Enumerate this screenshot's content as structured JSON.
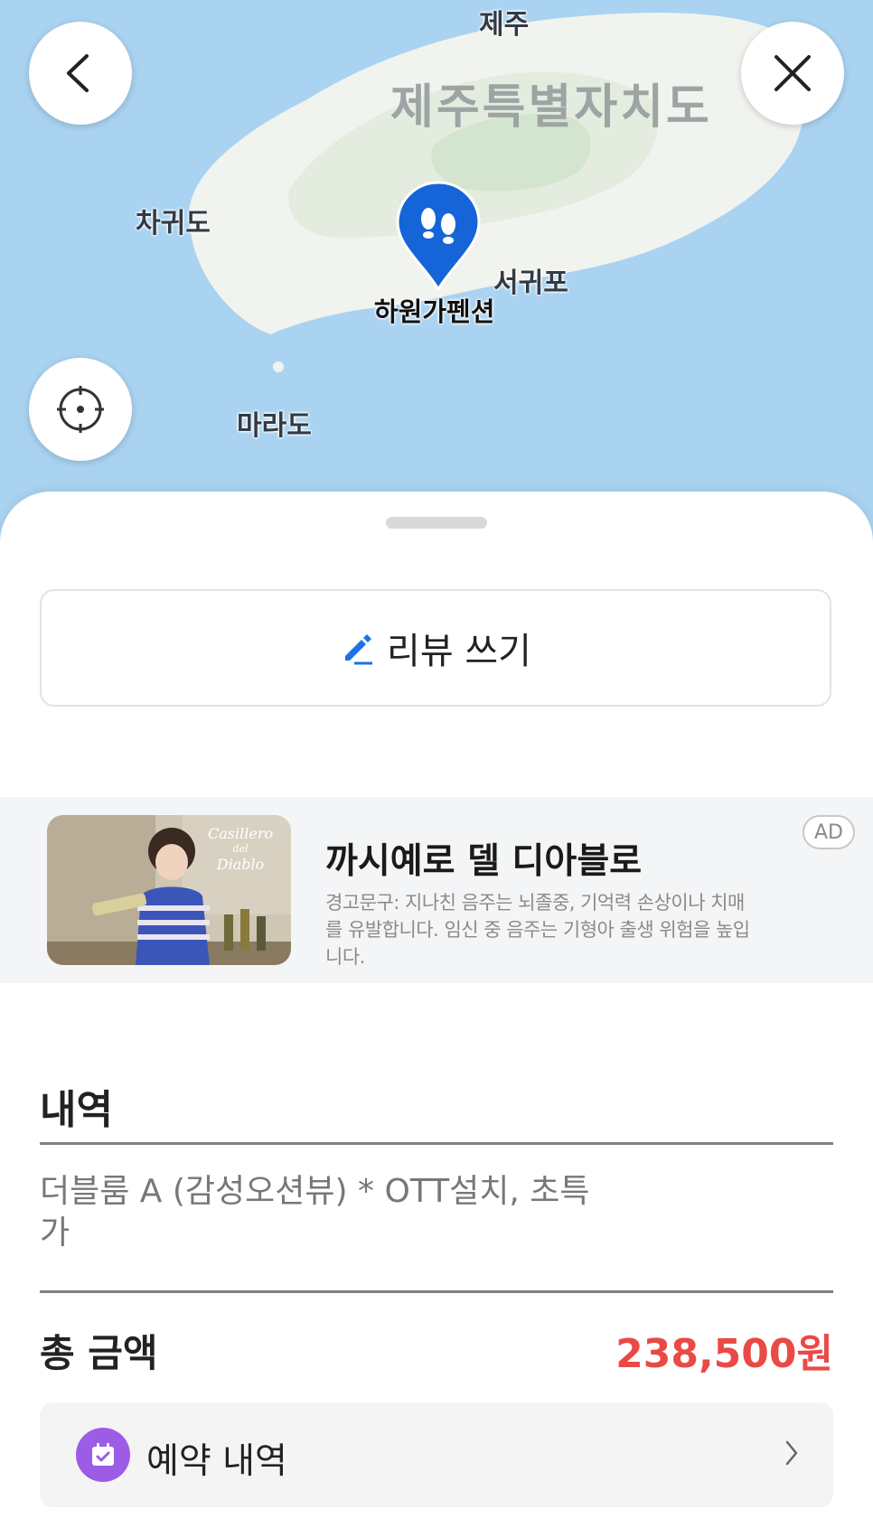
{
  "map": {
    "labels": {
      "jeju_city": "제주",
      "province": "제주특별자치도",
      "chagwido": "차귀도",
      "seogwipo": "서귀포",
      "marado": "마라도",
      "pin_place": "하원가펜션"
    },
    "buttons": {
      "back_icon": "chevron-left-icon",
      "close_icon": "close-icon",
      "locate_icon": "crosshair-icon"
    },
    "pin_icon": "footprints-icon",
    "colors": {
      "sea": "#a9d3f1",
      "land": "#f2f4f1",
      "pin": "#1565d8"
    }
  },
  "sheet": {
    "review_button_label": "리뷰 쓰기",
    "ad": {
      "badge": "AD",
      "title": "까시예로 델 디아블로",
      "desc": "경고문구: 지나친 음주는 뇌졸중, 기억력 손상이나 치매를 유발합니다. 임신 중 음주는 기형아 출생 위험을 높입니다.",
      "image_brand_line1": "Casillero",
      "image_brand_line2": "del",
      "image_brand_line3": "Diablo"
    },
    "details_title": "내역",
    "item_name": "더블룸 A (감성오션뷰) * OTT설치, 초특가",
    "total_label": "총 금액",
    "total_amount": "238,500원",
    "booking_label": "예약 내역",
    "colors": {
      "accent_red": "#e94a45",
      "booking_icon_bg": "#9c5ce6",
      "pencil": "#1a73e8"
    }
  }
}
